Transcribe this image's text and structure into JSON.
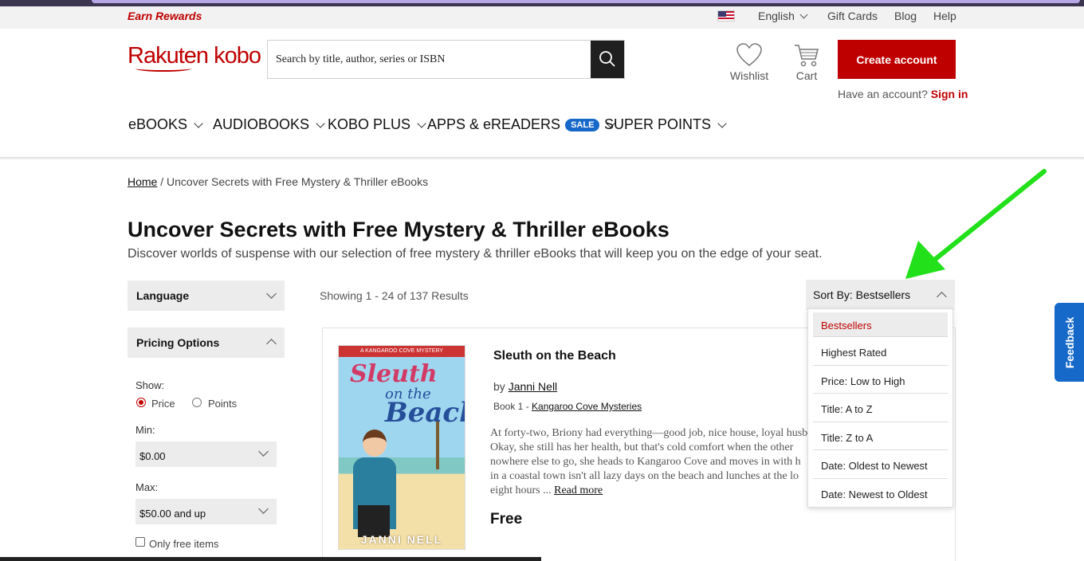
{
  "topbar": {
    "earn_rewards": "Earn Rewards",
    "language": "English",
    "gift_cards": "Gift Cards",
    "blog": "Blog",
    "help": "Help"
  },
  "header": {
    "logo": "Rakuten kobo",
    "search_placeholder": "Search by title, author, series or ISBN",
    "wishlist": "Wishlist",
    "cart": "Cart",
    "create_account": "Create account",
    "have_account": "Have an account?",
    "sign_in": "Sign in"
  },
  "nav": {
    "items": [
      "eBOOKS",
      "AUDIOBOOKS",
      "KOBO PLUS",
      "APPS & eREADERS",
      "SUPER POINTS"
    ],
    "sale_badge": "SALE"
  },
  "breadcrumb": {
    "home": "Home",
    "current": "Uncover Secrets with Free Mystery & Thriller eBooks"
  },
  "page": {
    "title": "Uncover Secrets with Free Mystery & Thriller eBooks",
    "subtitle": "Discover worlds of suspense with our selection of free mystery & thriller eBooks that will keep you on the edge of your seat."
  },
  "filters": {
    "language": "Language",
    "pricing_options": "Pricing Options",
    "show_label": "Show:",
    "price": "Price",
    "points": "Points",
    "min_label": "Min:",
    "min_value": "$0.00",
    "max_label": "Max:",
    "max_value": "$50.00 and up",
    "only_free": "Only free items"
  },
  "results": {
    "count_text": "Showing 1 - 24 of 137 Results"
  },
  "sort": {
    "label": "Sort By: Bestsellers",
    "options": [
      "Bestsellers",
      "Highest Rated",
      "Price: Low to High",
      "Title: A to Z",
      "Title: Z to A",
      "Date: Oldest to Newest",
      "Date: Newest to Oldest"
    ]
  },
  "book": {
    "title": "Sleuth on the Beach",
    "by": "by",
    "author": "Janni Nell",
    "series_prefix": "Book 1 -",
    "series": "Kangaroo Cove Mysteries",
    "synopsis_lines": [
      "At forty-two, Briony had everything—good job, nice house, loyal husb",
      "Okay, she still has her health, but that's cold comfort when the other",
      "nowhere else to go, she heads to Kangaroo Cove and moves in with h",
      "in a coastal town isn't all lazy days on the beach and lunches at the lo",
      "eight hours ..."
    ],
    "read_more": "Read more",
    "price": "Free",
    "cover": {
      "banner": "A KANGAROO COVE MYSTERY",
      "title_word1": "Sleuth",
      "title_word2": "on the",
      "title_word3": "Beach",
      "author": "JANNI NELL"
    }
  },
  "feedback": "Feedback",
  "colors": {
    "brand_red": "#bf0000",
    "sale_blue": "#1669c9",
    "arrow_green": "#22e01a"
  }
}
